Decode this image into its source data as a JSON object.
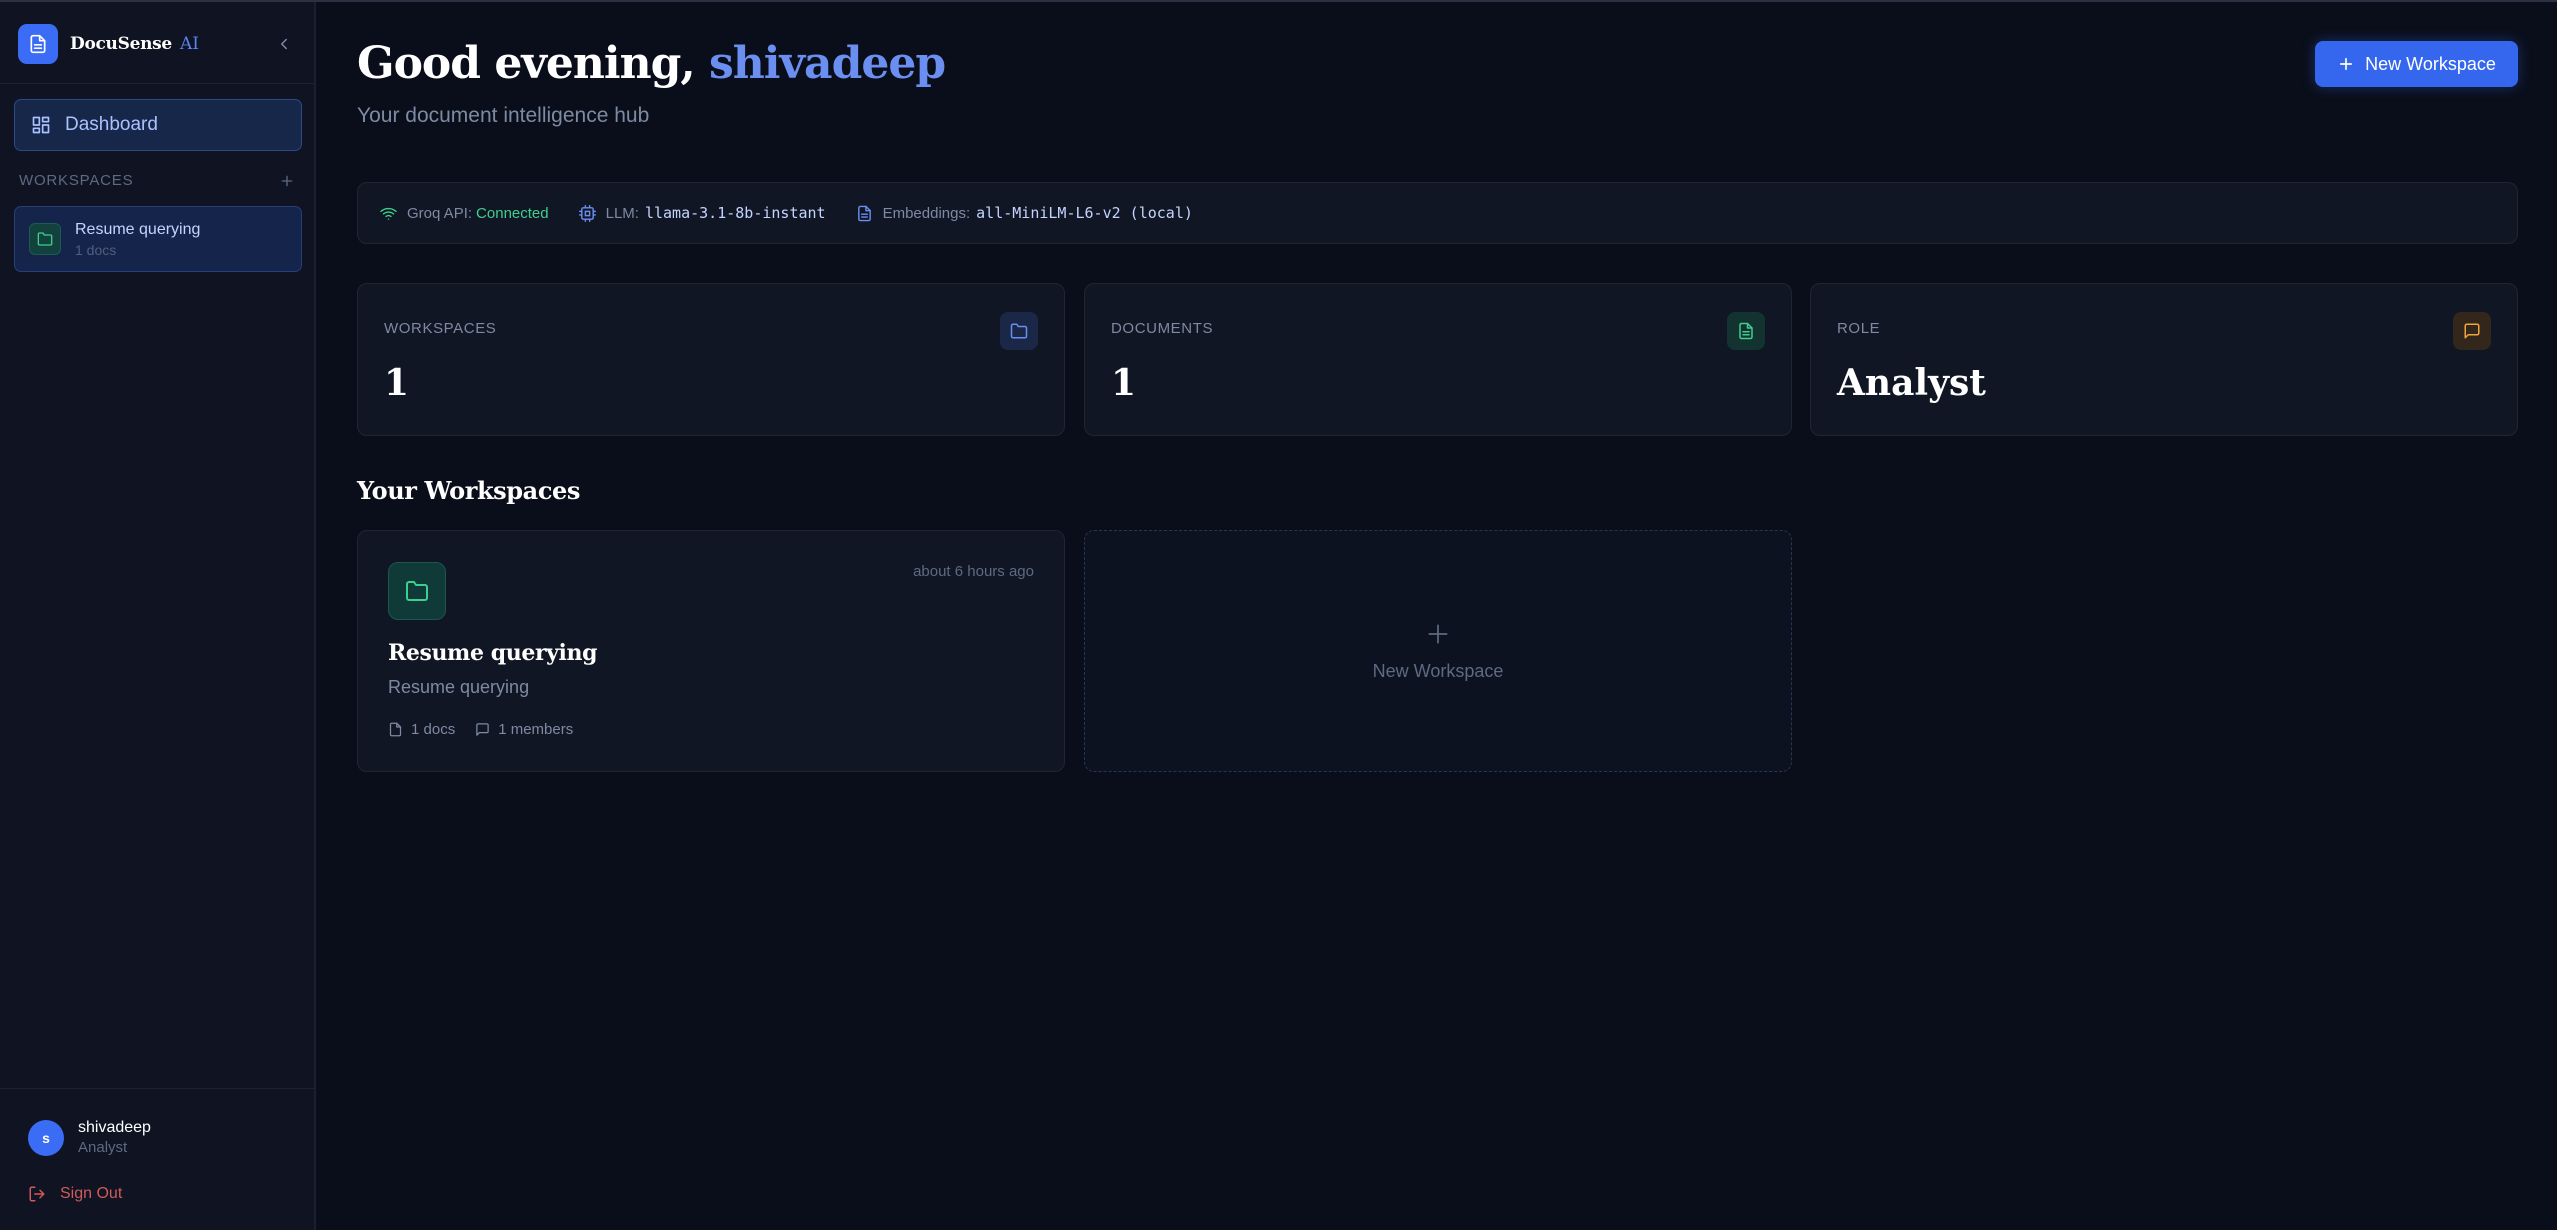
{
  "brand": {
    "name": "DocuSense",
    "suffix": "AI"
  },
  "sidebar": {
    "nav": {
      "dashboard_label": "Dashboard"
    },
    "workspaces_header": "WORKSPACES",
    "workspaces": [
      {
        "title": "Resume querying",
        "subtitle": "1 docs"
      }
    ],
    "user": {
      "initial": "s",
      "name": "shivadeep",
      "role": "Analyst"
    },
    "sign_out_label": "Sign Out"
  },
  "header": {
    "greeting_prefix": "Good evening, ",
    "username": "shivadeep",
    "subtitle": "Your document intelligence hub",
    "new_workspace_label": "New Workspace"
  },
  "status": {
    "groq_label": "Groq API:",
    "groq_value": "Connected",
    "llm_label": "LLM:",
    "llm_value": "llama-3.1-8b-instant",
    "embeddings_label": "Embeddings:",
    "embeddings_value": "all-MiniLM-L6-v2 (local)"
  },
  "stats": [
    {
      "label": "WORKSPACES",
      "value": "1"
    },
    {
      "label": "DOCUMENTS",
      "value": "1"
    },
    {
      "label": "ROLE",
      "value": "Analyst"
    }
  ],
  "section": {
    "title": "Your Workspaces"
  },
  "workspace_cards": [
    {
      "title": "Resume querying",
      "description": "Resume querying",
      "time": "about 6 hours ago",
      "docs": "1 docs",
      "members": "1 members"
    }
  ],
  "new_workspace_card_label": "New Workspace",
  "colors": {
    "accent": "#3566ee",
    "background": "#0a0e1a",
    "success": "#3ecf8e",
    "danger": "#d15a5a"
  },
  "icons": [
    "file-text-icon",
    "chevron-left-icon",
    "grid-icon",
    "plus-icon",
    "folder-icon",
    "wifi-icon",
    "cpu-icon",
    "message-square-icon",
    "log-out-icon"
  ]
}
